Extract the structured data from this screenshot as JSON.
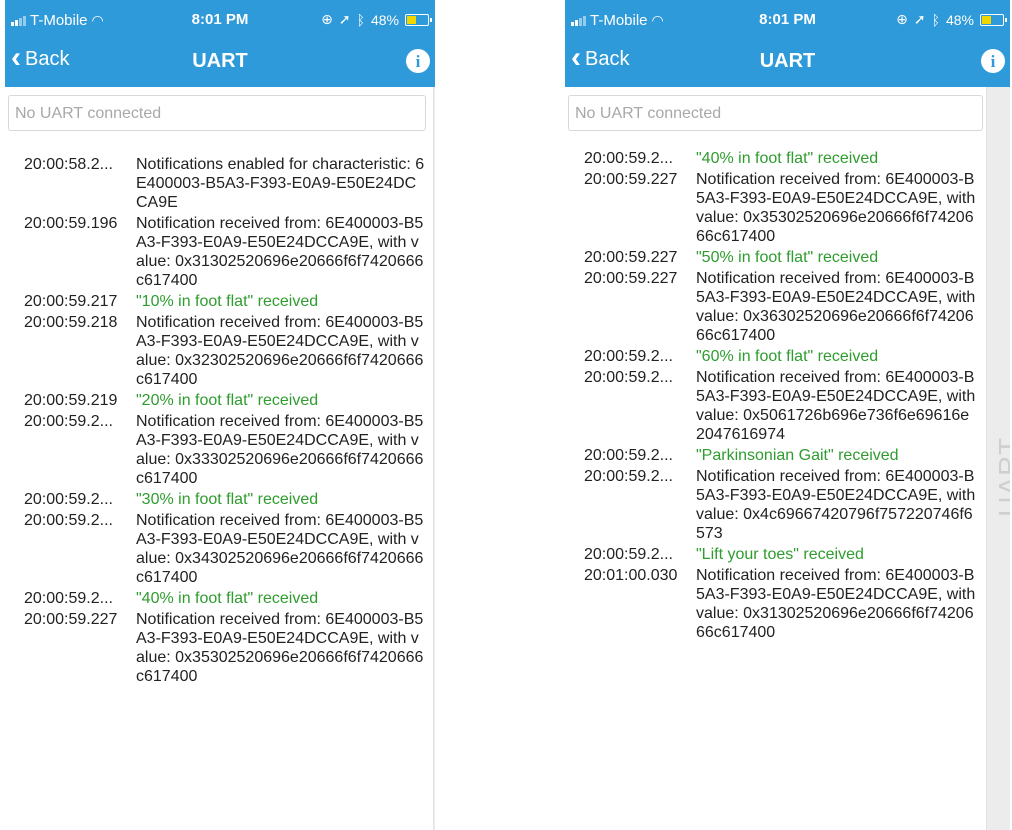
{
  "status": {
    "carrier": "T-Mobile",
    "time": "8:01 PM",
    "battery": "48%",
    "colors": {
      "header": "#2f9ad9",
      "battery_fill": "#f2d600",
      "received_text": "#2e9c2e"
    }
  },
  "nav": {
    "back_label": "Back",
    "title": "UART"
  },
  "search": {
    "placeholder": "No UART connected"
  },
  "side_tab": {
    "label": "UART"
  },
  "left_log": [
    {
      "time": "20:00:58.2...",
      "message": "Notifications enabled for characteristic: 6E400003-B5A3-F393-E0A9-E50E24DCCA9E",
      "green": false
    },
    {
      "time": "20:00:59.196",
      "message": "Notification received from: 6E400003-B5A3-F393-E0A9-E50E24DCCA9E, with value: 0x31302520696e20666f6f7420666c617400",
      "green": false
    },
    {
      "time": "20:00:59.217",
      "message": "\"10% in foot flat\" received",
      "green": true
    },
    {
      "time": "20:00:59.218",
      "message": "Notification received from: 6E400003-B5A3-F393-E0A9-E50E24DCCA9E, with value: 0x32302520696e20666f6f7420666c617400",
      "green": false
    },
    {
      "time": "20:00:59.219",
      "message": "\"20% in foot flat\" received",
      "green": true
    },
    {
      "time": "20:00:59.2...",
      "message": "Notification received from: 6E400003-B5A3-F393-E0A9-E50E24DCCA9E, with value: 0x33302520696e20666f6f7420666c617400",
      "green": false
    },
    {
      "time": "20:00:59.2...",
      "message": "\"30% in foot flat\" received",
      "green": true
    },
    {
      "time": "20:00:59.2...",
      "message": "Notification received from: 6E400003-B5A3-F393-E0A9-E50E24DCCA9E, with value: 0x34302520696e20666f6f7420666c617400",
      "green": false
    },
    {
      "time": "20:00:59.2...",
      "message": "\"40% in foot flat\" received",
      "green": true
    },
    {
      "time": "20:00:59.227",
      "message": "Notification received from: 6E400003-B5A3-F393-E0A9-E50E24DCCA9E, with value: 0x35302520696e20666f6f7420666c617400",
      "green": false
    }
  ],
  "right_log": [
    {
      "time": "",
      "message": "66c617400",
      "green": false
    },
    {
      "time": "20:00:59.2...",
      "message": "\"40% in foot flat\" received",
      "green": true
    },
    {
      "time": "20:00:59.227",
      "message": "Notification received from: 6E400003-B5A3-F393-E0A9-E50E24DCCA9E, with value: 0x35302520696e20666f6f7420666c617400",
      "green": false
    },
    {
      "time": "20:00:59.227",
      "message": "\"50% in foot flat\" received",
      "green": true
    },
    {
      "time": "20:00:59.227",
      "message": "Notification received from: 6E400003-B5A3-F393-E0A9-E50E24DCCA9E, with value: 0x36302520696e20666f6f7420666c617400",
      "green": false
    },
    {
      "time": "20:00:59.2...",
      "message": "\"60% in foot flat\" received",
      "green": true
    },
    {
      "time": "20:00:59.2...",
      "message": "Notification received from: 6E400003-B5A3-F393-E0A9-E50E24DCCA9E, with value: 0x5061726b696e736f6e69616e2047616974",
      "green": false
    },
    {
      "time": "20:00:59.2...",
      "message": "\"Parkinsonian Gait\" received",
      "green": true
    },
    {
      "time": "20:00:59.2...",
      "message": "Notification received from: 6E400003-B5A3-F393-E0A9-E50E24DCCA9E, with value: 0x4c69667420796f757220746f6573",
      "green": false
    },
    {
      "time": "20:00:59.2...",
      "message": "\"Lift your toes\" received",
      "green": true
    },
    {
      "time": "20:01:00.030",
      "message": "Notification received from: 6E400003-B5A3-F393-E0A9-E50E24DCCA9E, with value: 0x31302520696e20666f6f7420666c617400",
      "green": false
    }
  ]
}
